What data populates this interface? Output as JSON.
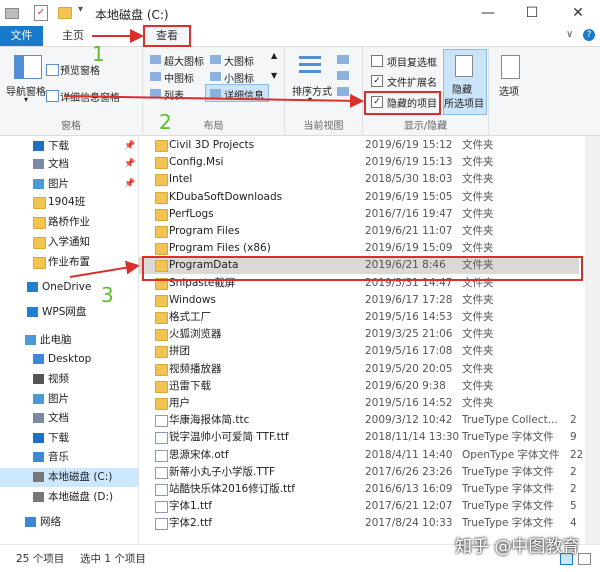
{
  "window": {
    "title": "本地磁盘 (C:)",
    "minimize": "—",
    "maximize": "☐",
    "close": "✕"
  },
  "tabs": {
    "file": "文件",
    "home": "主页",
    "view": "查看"
  },
  "ribbon": {
    "pane": {
      "nav_pane": "导航窗格",
      "preview": "预览窗格",
      "details": "详细信息窗格",
      "label": "窗格"
    },
    "layout": {
      "xlarge": "超大图标",
      "large": "大图标",
      "medium": "中图标",
      "small": "小图标",
      "list": "列表",
      "details": "详细信息",
      "label": "布局"
    },
    "current_view": {
      "sort": "排序方式",
      "label": "当前视图"
    },
    "show_hide": {
      "item_checkboxes": "项目复选框",
      "extensions": "文件扩展名",
      "hidden_items": "隐藏的项目",
      "hide": "隐藏",
      "hide_selected": "所选项目",
      "options": "选项",
      "label": "显示/隐藏"
    }
  },
  "annotations": {
    "n1": "1",
    "n2": "2",
    "n3": "3"
  },
  "nav": [
    {
      "label": "下载",
      "icon": "download-icon"
    },
    {
      "label": "文档",
      "icon": "document-icon"
    },
    {
      "label": "图片",
      "icon": "picture-icon"
    },
    {
      "label": "1904班",
      "icon": "folder-icon"
    },
    {
      "label": "路桥作业",
      "icon": "folder-icon"
    },
    {
      "label": "入学通知",
      "icon": "folder-icon"
    },
    {
      "label": "作业布置",
      "icon": "folder-icon"
    },
    {
      "label": "OneDrive",
      "icon": "cloud-icon"
    },
    {
      "label": "WPS网盘",
      "icon": "cloud-icon"
    },
    {
      "label": "此电脑",
      "icon": "computer-icon"
    },
    {
      "label": "Desktop",
      "icon": "desktop-icon"
    },
    {
      "label": "视频",
      "icon": "video-icon"
    },
    {
      "label": "图片",
      "icon": "picture-icon"
    },
    {
      "label": "文档",
      "icon": "document-icon"
    },
    {
      "label": "下载",
      "icon": "download-icon"
    },
    {
      "label": "音乐",
      "icon": "music-icon"
    },
    {
      "label": "本地磁盘 (C:)",
      "icon": "drive-icon"
    },
    {
      "label": "本地磁盘 (D:)",
      "icon": "drive-icon"
    },
    {
      "label": "网络",
      "icon": "network-icon"
    }
  ],
  "files": [
    {
      "name": "Civil 3D Projects",
      "date": "2019/6/19 15:12",
      "type": "文件夹",
      "size": "",
      "kind": "folder"
    },
    {
      "name": "Config.Msi",
      "date": "2019/6/19 15:13",
      "type": "文件夹",
      "size": "",
      "kind": "folder"
    },
    {
      "name": "Intel",
      "date": "2018/5/30 18:03",
      "type": "文件夹",
      "size": "",
      "kind": "folder"
    },
    {
      "name": "KDubaSoftDownloads",
      "date": "2019/6/19 15:05",
      "type": "文件夹",
      "size": "",
      "kind": "folder"
    },
    {
      "name": "PerfLogs",
      "date": "2016/7/16 19:47",
      "type": "文件夹",
      "size": "",
      "kind": "folder"
    },
    {
      "name": "Program Files",
      "date": "2019/6/21 11:07",
      "type": "文件夹",
      "size": "",
      "kind": "folder"
    },
    {
      "name": "Program Files (x86)",
      "date": "2019/6/19 15:09",
      "type": "文件夹",
      "size": "",
      "kind": "folder"
    },
    {
      "name": "ProgramData",
      "date": "2019/6/21 8:46",
      "type": "文件夹",
      "size": "",
      "kind": "folder"
    },
    {
      "name": "Snipaste截屏",
      "date": "2019/5/31 14:47",
      "type": "文件夹",
      "size": "",
      "kind": "folder"
    },
    {
      "name": "Windows",
      "date": "2019/6/17 17:28",
      "type": "文件夹",
      "size": "",
      "kind": "folder"
    },
    {
      "name": "格式工厂",
      "date": "2019/5/16 14:53",
      "type": "文件夹",
      "size": "",
      "kind": "folder"
    },
    {
      "name": "火狐浏览器",
      "date": "2019/3/25 21:06",
      "type": "文件夹",
      "size": "",
      "kind": "folder"
    },
    {
      "name": "拼团",
      "date": "2019/5/16 17:08",
      "type": "文件夹",
      "size": "",
      "kind": "folder"
    },
    {
      "name": "视频播放器",
      "date": "2019/5/20 20:05",
      "type": "文件夹",
      "size": "",
      "kind": "folder"
    },
    {
      "name": "迅雷下载",
      "date": "2019/6/20 9:38",
      "type": "文件夹",
      "size": "",
      "kind": "folder"
    },
    {
      "name": "用户",
      "date": "2019/5/16 14:52",
      "type": "文件夹",
      "size": "",
      "kind": "folder"
    },
    {
      "name": "华康海报体简.ttc",
      "date": "2009/3/12 10:42",
      "type": "TrueType Collect...",
      "size": "2",
      "kind": "file"
    },
    {
      "name": "锐字温帅小可爱简 TTF.ttf",
      "date": "2018/11/14 13:30",
      "type": "TrueType 字体文件",
      "size": "9",
      "kind": "file"
    },
    {
      "name": "思源宋体.otf",
      "date": "2018/4/11 14:40",
      "type": "OpenType 字体文件",
      "size": "22",
      "kind": "file"
    },
    {
      "name": "新蒂小丸子小学版.TTF",
      "date": "2017/6/26 23:26",
      "type": "TrueType 字体文件",
      "size": "2",
      "kind": "file"
    },
    {
      "name": "站酷快乐体2016修订版.ttf",
      "date": "2016/6/13 16:09",
      "type": "TrueType 字体文件",
      "size": "2",
      "kind": "file"
    },
    {
      "name": "字体1.ttf",
      "date": "2017/6/21 12:07",
      "type": "TrueType 字体文件",
      "size": "5",
      "kind": "file"
    },
    {
      "name": "字体2.ttf",
      "date": "2017/8/24 10:33",
      "type": "TrueType 字体文件",
      "size": "4",
      "kind": "file"
    }
  ],
  "status": {
    "count": "25 个项目",
    "selected": "选中 1 个项目"
  },
  "watermark": "知乎 @中图教育"
}
